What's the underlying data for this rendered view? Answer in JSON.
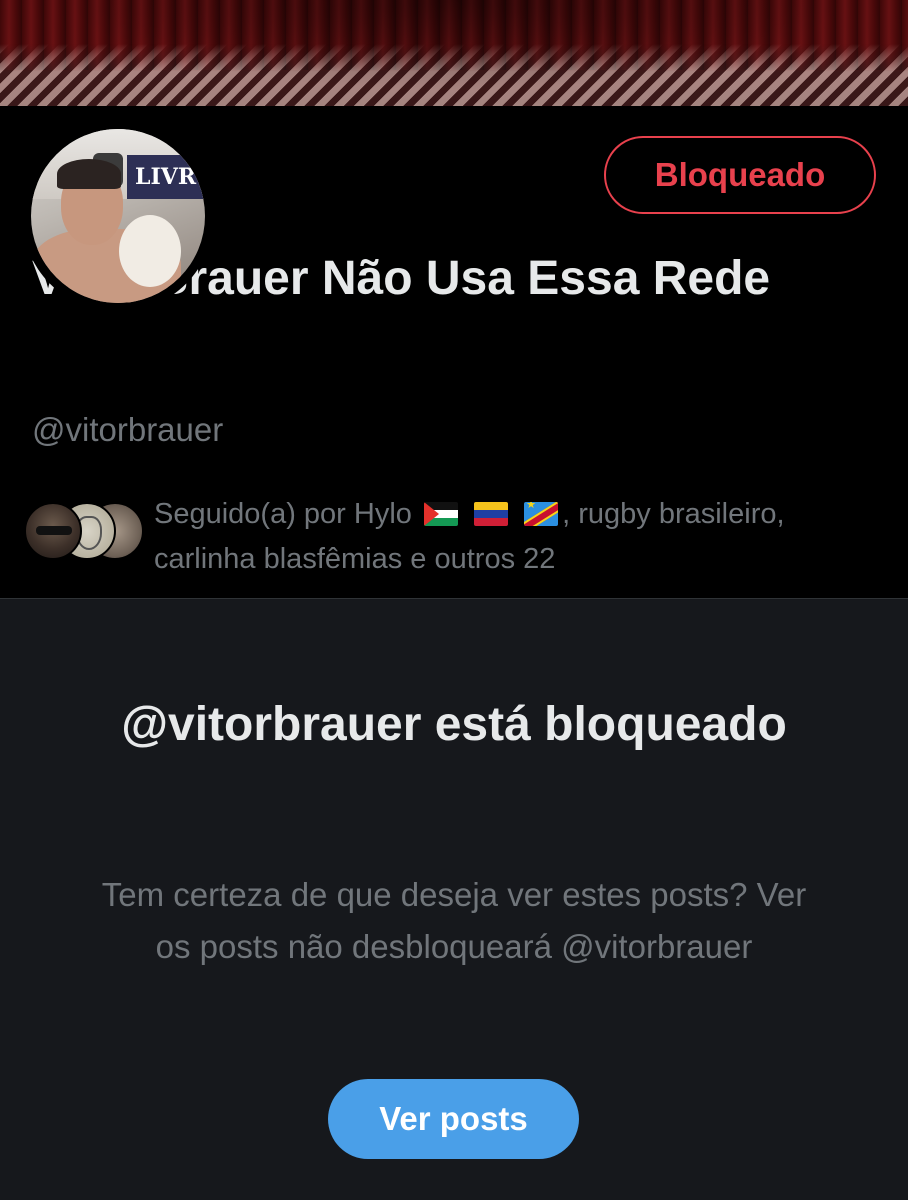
{
  "banner": {
    "description_icon": "profile-banner-image"
  },
  "profile": {
    "avatar_sign_text": "LIVR",
    "block_button_label": "Bloqueado",
    "display_name": "Vitor Brauer Não Usa Essa Rede",
    "handle": "@vitorbrauer",
    "followers": {
      "prefix": "Seguido(a) por Hylo",
      "flags": [
        "flag-palestine",
        "flag-venezuela",
        "flag-dr-congo"
      ],
      "suffix": ", rugby brasileiro, carlinha blasfêmias e outros 22"
    }
  },
  "blocked": {
    "title": "@vitorbrauer está bloqueado",
    "description": "Tem certeza de que deseja ver estes posts? Ver os posts não desbloqueará @vitorbrauer",
    "view_button_label": "Ver posts"
  },
  "colors": {
    "background": "#000000",
    "blocked_background": "#16181c",
    "primary_text": "#e7e9ea",
    "secondary_text": "#71767b",
    "danger": "#e8414d",
    "accent": "#4a9fe8"
  }
}
